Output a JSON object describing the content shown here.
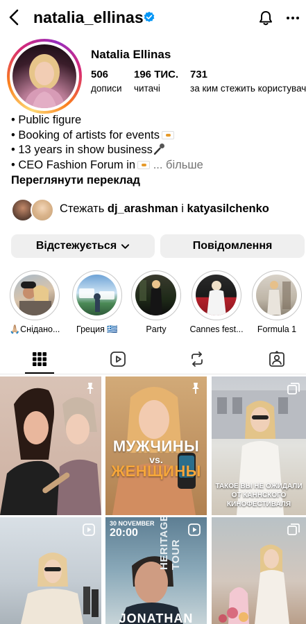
{
  "header": {
    "username": "natalia_ellinas"
  },
  "profile": {
    "full_name": "Natalia Ellinas",
    "stats": [
      {
        "value": "506",
        "label": "дописи"
      },
      {
        "value": "196 ТИС.",
        "label": "читачі"
      },
      {
        "value": "731",
        "label": "за ким стежить користувач"
      }
    ],
    "bio": [
      "• Public figure",
      "• Booking of artists for events",
      "• 13 years in show business",
      "• CEO Fashion Forum in"
    ],
    "bio_more": "... більше",
    "translate": "Переглянути переклад",
    "followed_by_prefix": "Стежать",
    "followed_by_1": "dj_arashman",
    "followed_by_sep": "і",
    "followed_by_2": "katyasilchenko"
  },
  "actions": {
    "following_label": "Відстежується",
    "message_label": "Повідомлення"
  },
  "highlights": [
    {
      "label": "🙏🏼Снідано..."
    },
    {
      "label": "Греция 🇬🇷"
    },
    {
      "label": "Party"
    },
    {
      "label": "Cannes fest..."
    },
    {
      "label": "Formula 1"
    }
  ],
  "tabs": [
    "grid-icon",
    "reels-icon",
    "reposts-icon",
    "tagged-icon"
  ],
  "posts": [
    {
      "kind": "pinned"
    },
    {
      "kind": "pinned",
      "text_top": "МУЖЧИНЫ",
      "text_mid": "vs.",
      "text_bot": "ЖЕНЩИНЫ"
    },
    {
      "kind": "carousel",
      "caption": "ТАКОЕ ВЫ НЕ ОЖИДАЛИ ОТ КАННСКОГО КИНОФЕСТИВАЛЯ"
    },
    {
      "kind": "reel"
    },
    {
      "kind": "reel",
      "date": "30 NOVEMBER",
      "time": "20:00",
      "side": "HERITAGE DASSIN TOUR",
      "name": "JONATHAN"
    },
    {
      "kind": "carousel"
    }
  ],
  "colors": {
    "accent": "#0095f6",
    "button_bg": "#efefef",
    "muted": "#737373"
  }
}
